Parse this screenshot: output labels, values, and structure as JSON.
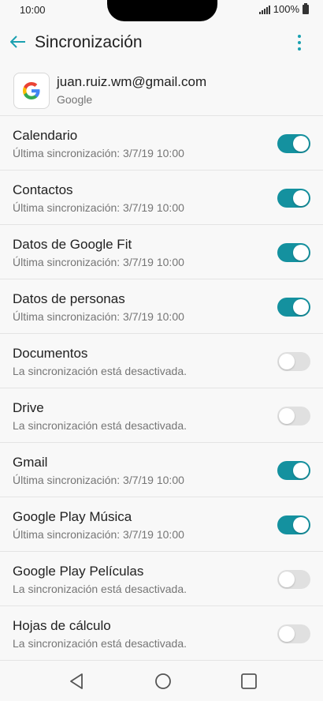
{
  "status": {
    "time": "10:00",
    "battery": "100%"
  },
  "app_bar": {
    "title": "Sincronización"
  },
  "account": {
    "email": "juan.ruiz.wm@gmail.com",
    "provider": "Google"
  },
  "items": [
    {
      "title": "Calendario",
      "subtitle": "Última sincronización: 3/7/19 10:00",
      "enabled": true
    },
    {
      "title": "Contactos",
      "subtitle": "Última sincronización: 3/7/19 10:00",
      "enabled": true
    },
    {
      "title": "Datos de Google Fit",
      "subtitle": "Última sincronización: 3/7/19 10:00",
      "enabled": true
    },
    {
      "title": "Datos de personas",
      "subtitle": "Última sincronización: 3/7/19 10:00",
      "enabled": true
    },
    {
      "title": "Documentos",
      "subtitle": "La sincronización está desactivada.",
      "enabled": false
    },
    {
      "title": "Drive",
      "subtitle": "La sincronización está desactivada.",
      "enabled": false
    },
    {
      "title": "Gmail",
      "subtitle": "Última sincronización: 3/7/19 10:00",
      "enabled": true
    },
    {
      "title": "Google Play Música",
      "subtitle": "Última sincronización: 3/7/19 10:00",
      "enabled": true
    },
    {
      "title": "Google Play Películas",
      "subtitle": "La sincronización está desactivada.",
      "enabled": false
    },
    {
      "title": "Hojas de cálculo",
      "subtitle": "La sincronización está desactivada.",
      "enabled": false
    }
  ],
  "colors": {
    "accent": "#14919f",
    "off_track": "#e0e0e0"
  }
}
